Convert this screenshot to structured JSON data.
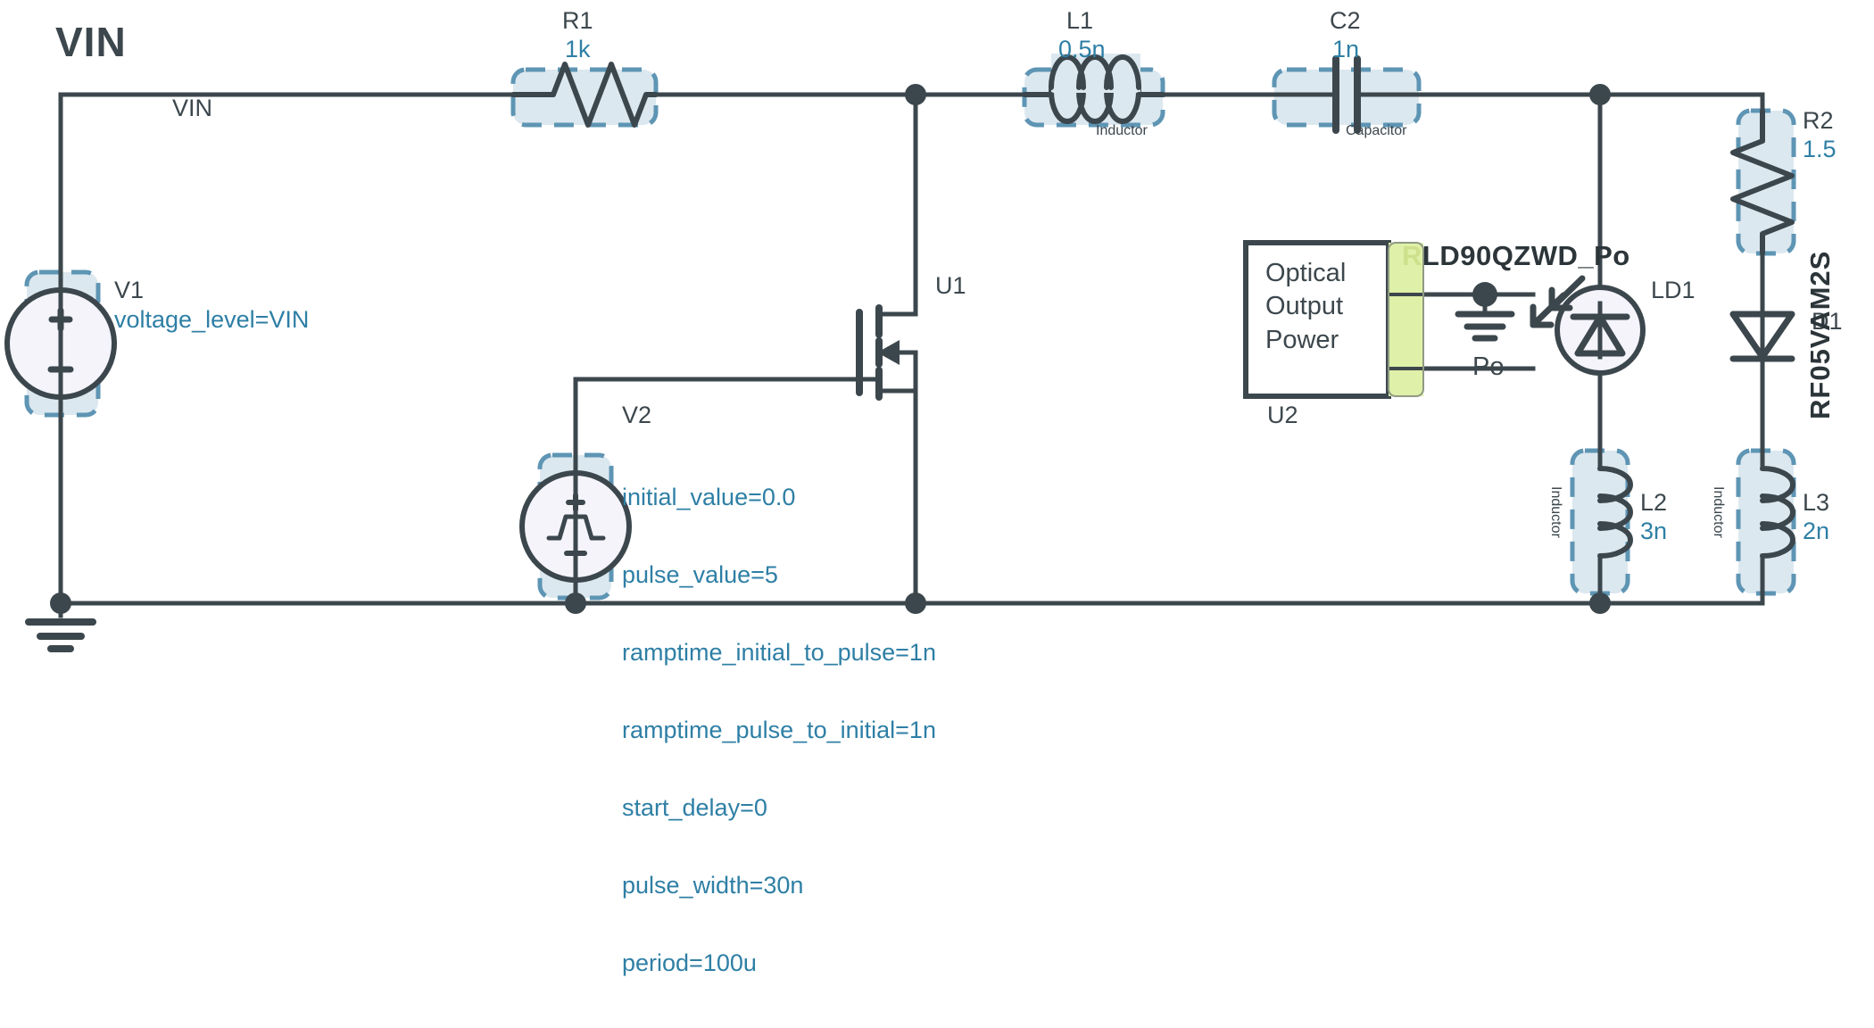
{
  "title": "VIN",
  "nets": {
    "vin_label": "VIN",
    "po_label": "Po"
  },
  "components": {
    "v1": {
      "ref": "V1",
      "param": "voltage_level=VIN",
      "type": "dc-voltage-source"
    },
    "r1": {
      "ref": "R1",
      "value": "1k",
      "type": "resistor"
    },
    "l1": {
      "ref": "L1",
      "value": "0.5n",
      "kind": "Inductor",
      "type": "inductor"
    },
    "c2": {
      "ref": "C2",
      "value": "1n",
      "kind": "Capacitor",
      "type": "capacitor"
    },
    "u1": {
      "ref": "U1",
      "type": "nmos-transistor"
    },
    "v2": {
      "ref": "V2",
      "type": "pulse-voltage-source",
      "params": [
        "initial_value=0.0",
        "pulse_value=5",
        "ramptime_initial_to_pulse=1n",
        "ramptime_pulse_to_initial=1n",
        "start_delay=0",
        "pulse_width=30n",
        "period=100u"
      ]
    },
    "u2": {
      "ref": "U2",
      "type": "optical-output-power-block",
      "lines": [
        "Optical",
        "Output",
        "Power"
      ],
      "part_prefix": "R",
      "part_name": "LD90QZWD_Po",
      "pin_bottom_label": "Po"
    },
    "ld1": {
      "ref": "LD1",
      "type": "laser-diode"
    },
    "r2": {
      "ref": "R2",
      "value": "1.5",
      "type": "resistor"
    },
    "d1": {
      "ref": "D1",
      "part_name": "RF05VAM2S",
      "type": "diode"
    },
    "l2": {
      "ref": "L2",
      "value": "3n",
      "kind": "Inductor",
      "type": "inductor"
    },
    "l3": {
      "ref": "L3",
      "value": "2n",
      "kind": "Inductor",
      "type": "inductor"
    }
  },
  "colors": {
    "wire": "#3c474d",
    "selection_fill": "#dce8ef",
    "selection_stroke": "#5e95b4",
    "value_text": "#2e7fa5",
    "ref_text": "#3c474d",
    "block_highlight": "#dff0a8"
  }
}
